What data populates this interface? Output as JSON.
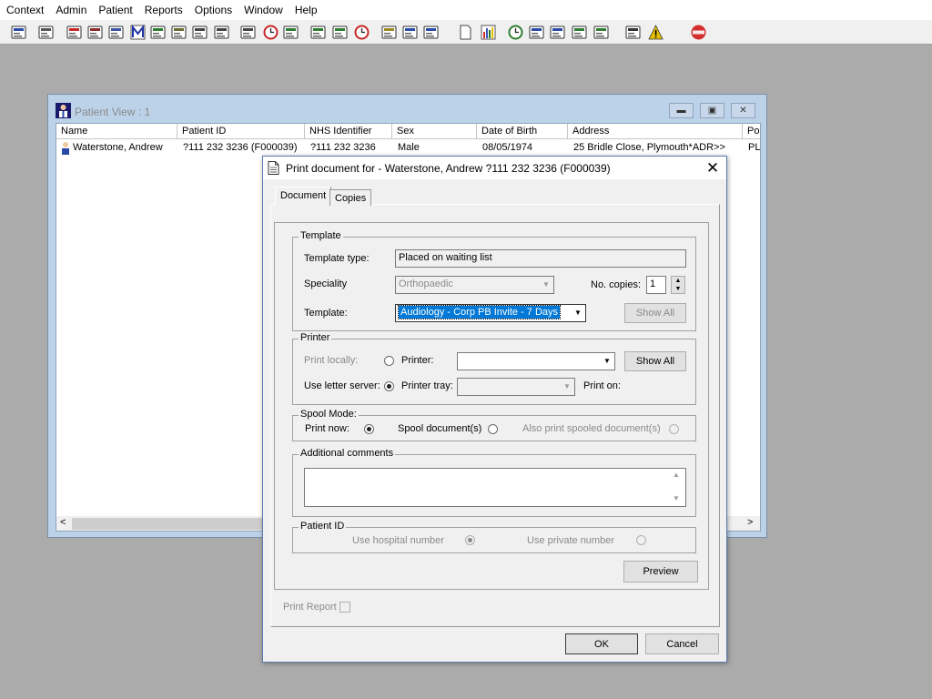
{
  "menu": [
    "Context",
    "Admin",
    "Patient",
    "Reports",
    "Options",
    "Window",
    "Help"
  ],
  "toolbar_icons": [
    {
      "name": "patient-lookup-icon",
      "color": "#2a4aa8"
    },
    {
      "name": "printer-icon",
      "color": "#555555"
    },
    {
      "name": "book-red-icon",
      "color": "#c62828"
    },
    {
      "name": "edit-record-icon",
      "color": "#8e2c2c"
    },
    {
      "name": "report-icon",
      "color": "#3a56a0"
    },
    {
      "name": "m-letter-icon",
      "color": "#2233aa"
    },
    {
      "name": "doctor-icon",
      "color": "#2e7d32"
    },
    {
      "name": "notes-icon",
      "color": "#6a6a30"
    },
    {
      "name": "vehicle-icon",
      "color": "#444444"
    },
    {
      "name": "ambulance-icon",
      "color": "#444444"
    },
    {
      "name": "search-document-icon",
      "color": "#444444"
    },
    {
      "name": "clock-icon",
      "color": "#c62828"
    },
    {
      "name": "list-window-icon",
      "color": "#2e7d32"
    },
    {
      "name": "picture-icon",
      "color": "#2e7d32"
    },
    {
      "name": "screen-icon",
      "color": "#2e7d32"
    },
    {
      "name": "dial-icon",
      "color": "#c62828"
    },
    {
      "name": "note-pad-icon",
      "color": "#9a8a20"
    },
    {
      "name": "bed-icon",
      "color": "#2a4aa8"
    },
    {
      "name": "person-bed-icon",
      "color": "#2a4aa8"
    },
    {
      "name": "blank-page-icon",
      "color": "#555555"
    },
    {
      "name": "bar-chart-icon",
      "color": "#3a56c0"
    },
    {
      "name": "globe-icon",
      "color": "#2e7d32"
    },
    {
      "name": "check-list-icon",
      "color": "#2a4aa8"
    },
    {
      "name": "check-list-edit-icon",
      "color": "#2a4aa8"
    },
    {
      "name": "arrow-down-green-icon",
      "color": "#2e7d32"
    },
    {
      "name": "arrow-right-green-icon",
      "color": "#2e7d32"
    },
    {
      "name": "swap-arrows-icon",
      "color": "#333333"
    },
    {
      "name": "warning-icon",
      "color": "#e5c100"
    },
    {
      "name": "exit-icon",
      "color": "#d32f2f"
    }
  ],
  "patient_window": {
    "title": "Patient View : 1",
    "columns": [
      "Name",
      "Patient ID",
      "NHS Identifier",
      "Sex",
      "Date of Birth",
      "Address",
      "Po"
    ],
    "rows": [
      [
        "Waterstone, Andrew",
        "?111 232 3236 (F000039)",
        "?111 232 3236",
        "Male",
        "08/05/1974",
        "25 Bridle Close, Plymouth*ADR>>",
        "PL"
      ]
    ]
  },
  "dialog": {
    "title": "Print document for - Waterstone, Andrew ?111 232 3236 (F000039)",
    "tabs": [
      "Document",
      "Copies"
    ],
    "template": {
      "group_label": "Template",
      "template_type_label": "Template type:",
      "template_type_value": "Placed on waiting list",
      "speciality_label": "Speciality",
      "speciality_value": "Orthopaedic",
      "copies_label": "No. copies:",
      "copies_value": "1",
      "template_label": "Template:",
      "template_value": "Audiology - Corp PB Invite - 7 Days",
      "show_all_label": "Show All"
    },
    "printer": {
      "group_label": "Printer",
      "print_locally_label": "Print locally:",
      "printer_label": "Printer:",
      "printer_value": "",
      "show_all_label": "Show All",
      "letter_server_label": "Use letter server:",
      "printer_tray_label": "Printer tray:",
      "print_on_label": "Print on:"
    },
    "spool": {
      "group_label": "Spool Mode:",
      "print_now_label": "Print now:",
      "spool_label": "Spool document(s)",
      "also_print_label": "Also print spooled document(s)"
    },
    "comments": {
      "group_label": "Additional comments",
      "value": ""
    },
    "patient_id": {
      "group_label": "Patient ID",
      "hospital_label": "Use hospital number",
      "private_label": "Use private number"
    },
    "preview_label": "Preview",
    "print_report_label": "Print Report",
    "ok_label": "OK",
    "cancel_label": "Cancel"
  }
}
